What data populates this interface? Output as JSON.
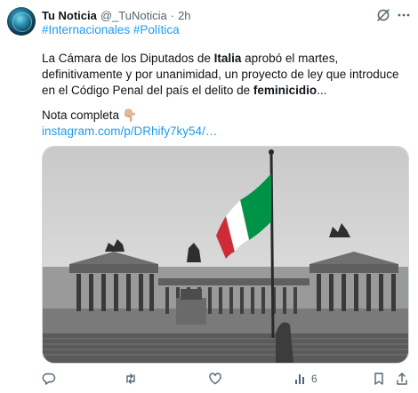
{
  "tweet": {
    "author_name": "Tu Noticia",
    "handle": "@_TuNoticia",
    "separator": "·",
    "time": "2h",
    "hashtags": [
      "#Internacionales",
      "#Política"
    ],
    "text_segments": [
      {
        "text": "La Cámara de los Diputados de ",
        "bold": false
      },
      {
        "text": "Italia",
        "bold": true
      },
      {
        "text": " aprobó el martes, definitivamente y por unanimidad, un proyecto de ley que introduce en el Código Penal del país el delito de ",
        "bold": false
      },
      {
        "text": "feminicidio",
        "bold": true
      },
      {
        "text": "...",
        "bold": false
      }
    ],
    "nota_label": "Nota completa",
    "nota_emoji": "👇🏼",
    "link_text": "instagram.com/p/DRhify7ky54/…",
    "media": {
      "description_icon": "image",
      "flag_colors": [
        "#009246",
        "#ffffff",
        "#ce2b37"
      ]
    }
  },
  "actions": {
    "reply_count": "",
    "retweet_count": "",
    "like_count": "",
    "views_count": "6",
    "bookmark_count": ""
  },
  "colors": {
    "link": "#1d9bf0",
    "secondary_text": "#536471",
    "border": "#cfd9de"
  },
  "icons": [
    "grok-icon",
    "more-icon",
    "reply-icon",
    "retweet-icon",
    "like-icon",
    "views-icon",
    "bookmark-icon",
    "share-icon"
  ]
}
